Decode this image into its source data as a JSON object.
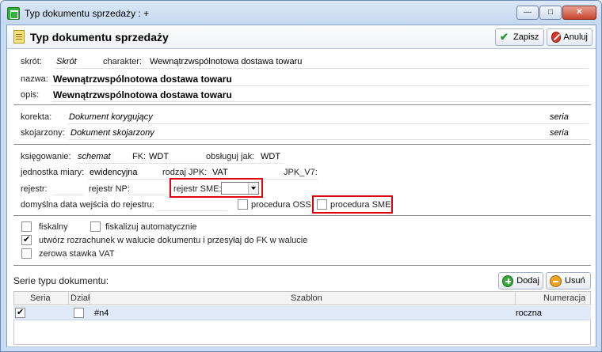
{
  "window": {
    "title": "Typ dokumentu sprzedaży : +"
  },
  "header": {
    "title": "Typ dokumentu sprzedaży",
    "save_label": "Zapisz",
    "cancel_label": "Anuluj"
  },
  "fields": {
    "skrot_label": "skrót:",
    "skrot_value": "Skrót",
    "charakter_label": "charakter:",
    "charakter_value": "Wewnątrzwspólnotowa dostawa towaru",
    "nazwa_label": "nazwa:",
    "nazwa_value": "Wewnątrzwspólnotowa dostawa towaru",
    "opis_label": "opis:",
    "opis_value": "Wewnątrzwspólnotowa dostawa towaru"
  },
  "related": {
    "korekta_label": "korekta:",
    "korekta_value": "Dokument korygujący",
    "korekta_seria": "seria",
    "skojarzony_label": "skojarzony:",
    "skojarzony_value": "Dokument skojarzony",
    "skojarzony_seria": "seria"
  },
  "settings": {
    "ksiegowanie_label": "księgowanie:",
    "ksiegowanie_value": "schemat",
    "fk_label": "FK:",
    "fk_value": "WDT",
    "obsluguj_label": "obsługuj jak:",
    "obsluguj_value": "WDT",
    "jm_label": "jednostka miary:",
    "jm_value": "ewidencyjna",
    "rodzaj_jpk_label": "rodzaj JPK:",
    "rodzaj_jpk_value": "VAT",
    "jpk_v7_label": "JPK_V7:",
    "rejestr_label": "rejestr:",
    "rejestr_np_label": "rejestr NP:",
    "rejestr_sme_label": "rejestr SME:",
    "data_wejscia_label": "domyślna data wejścia do rejestru:",
    "procedura_oss_label": "procedura OSS",
    "procedura_sme_label": "procedura SME"
  },
  "options": {
    "fiskalny": "fiskalny",
    "fiskalizuj": "fiskalizuj automatycznie",
    "rozrachunek": "utwórz rozrachunek w walucie dokumentu i przesyłaj do FK w walucie",
    "zerowa": "zerowa stawka VAT"
  },
  "series": {
    "title": "Serie typu dokumentu:",
    "add_label": "Dodaj",
    "delete_label": "Usuń",
    "columns": [
      "Seria",
      "Dział",
      "Szablon",
      "Numeracja"
    ],
    "rows": [
      {
        "szablon": "#n4",
        "numeracja": "roczna",
        "seria_checked": true,
        "dzial_checked": false
      }
    ]
  },
  "colors": {
    "highlight": "#e0000f",
    "selected_row": "#dfe9f8"
  }
}
